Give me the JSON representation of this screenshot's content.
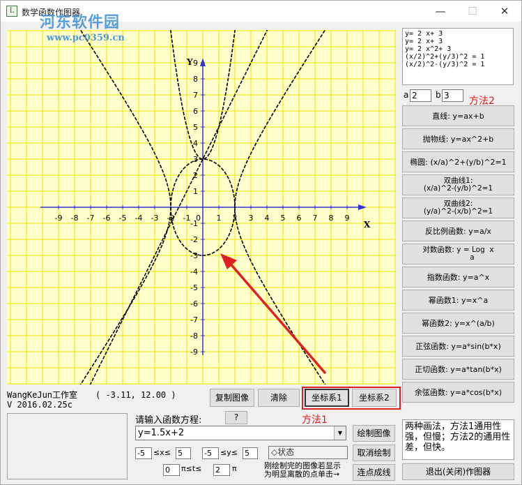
{
  "window": {
    "title": "数学函数作图器",
    "icon_glyph": "L",
    "minimize": "—",
    "maximize": "☐",
    "close": "✕"
  },
  "watermark": {
    "text": "河东软件园",
    "url": "www.pc0359.cn"
  },
  "plot": {
    "x_axis_label": "X",
    "y_axis_label": "Y",
    "x_ticks": [
      -9,
      -8,
      -7,
      -6,
      -5,
      -4,
      -3,
      -2,
      -1,
      0,
      1,
      2,
      3,
      4,
      5,
      6,
      7,
      8,
      9
    ],
    "y_ticks": [
      9,
      8,
      7,
      6,
      5,
      4,
      3,
      2,
      1,
      -1,
      -2,
      -3,
      -4,
      -5,
      -6,
      -7,
      -8,
      -9
    ],
    "origin_label": "0",
    "colors": {
      "background": "#ffffcc",
      "grid": "#f0e000",
      "axis": "#3333cc",
      "curve": "#000000",
      "arrow": "#e02020"
    }
  },
  "equations": [
    "y= 2 x+ 3",
    "y= 2 x+ 3",
    "y= 2 x^2+ 3",
    "(x/2)^2+(y/3)^2 = 1",
    "(x/2)^2-(y/3)^2 = 1"
  ],
  "params": {
    "a_label": "a",
    "a_value": "2",
    "b_label": "b",
    "b_value": "3",
    "method2": "方法2"
  },
  "function_buttons": [
    "直线: y=ax+b",
    "抛物线: y=ax^2+b",
    "椭圆: (x/a)^2+(y/b)^2=1",
    "双曲线1:\n(x/a)^2-(y/b)^2=1",
    "双曲线2:\n(y/a)^2-(x/b)^2=1",
    "反比例函数: y=a/x",
    "对数函数: y = Log  x\n            a",
    "指数函数: y=a^x",
    "幂函数1: y=x^a",
    "幂函数2: y=x^(a/b)",
    "正弦函数: y=a*sin(b*x)",
    "正切函数: y=a*tan(b*x)",
    "余弦函数: y=a*cos(b*x)"
  ],
  "footer": {
    "brand": "WangKeJun工作室\nV 2016.02.25c",
    "coordinate": "( -3.11, 12.00 )",
    "copy_image": "复制图像",
    "clear": "清除",
    "coord_sys1": "坐标系1",
    "coord_sys2": "坐标系2",
    "prompt": "请输入函数方程:",
    "help": "?",
    "method1": "方法1",
    "function_value": "y=1.5x+2",
    "draw": "绘制图像",
    "cancel_draw": "取消绘制",
    "connect": "连点成线",
    "x_min": "-5",
    "x_range_text": "≤x≤",
    "x_max": "5",
    "y_min": "-5",
    "y_range_text": "≤y≤",
    "y_max": "5",
    "status": "状态",
    "t_min": "0",
    "t_range_text": "π≤t≤",
    "t_max": "2",
    "t_unit": "π",
    "hint": "刚绘制完的图像若显示\n为明显离散的点单击→",
    "note": "两种画法，方法1通用性强，但慢；方法2的通用性差，但快。",
    "exit": "退出(关闭)作图器"
  }
}
